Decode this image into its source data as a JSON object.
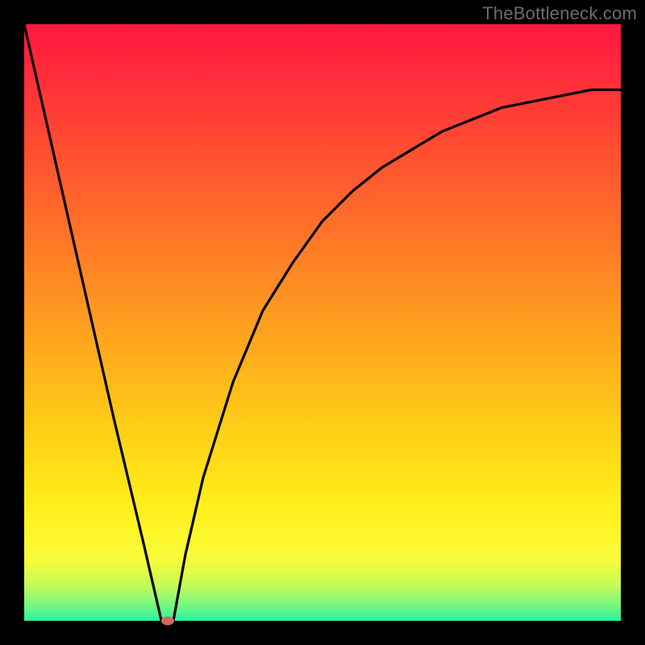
{
  "watermark": "TheBottleneck.com",
  "colors": {
    "page_bg": "#000000",
    "curve_stroke": "#000000",
    "dot_fill": "#d06a5e",
    "gradient_top": "#ff173f",
    "gradient_bottom": "#2af3a0"
  },
  "chart_data": {
    "type": "line",
    "title": "",
    "xlabel": "",
    "ylabel": "",
    "xlim": [
      0,
      100
    ],
    "ylim": [
      0,
      100
    ],
    "grid": false,
    "series": [
      {
        "name": "curve",
        "x": [
          0,
          5,
          10,
          15,
          20,
          23,
          25,
          27,
          30,
          35,
          40,
          45,
          50,
          55,
          60,
          65,
          70,
          75,
          80,
          85,
          90,
          95,
          100
        ],
        "values": [
          100,
          78,
          56,
          34,
          13,
          0,
          0,
          11,
          24,
          40,
          52,
          60,
          67,
          72,
          76,
          79,
          82,
          84,
          86,
          87,
          88,
          89,
          89
        ]
      }
    ],
    "marker": {
      "x": 24,
      "y": 0
    },
    "note": "Values estimated from pixel positions; axes have no visible ticks or labels in the source image."
  }
}
